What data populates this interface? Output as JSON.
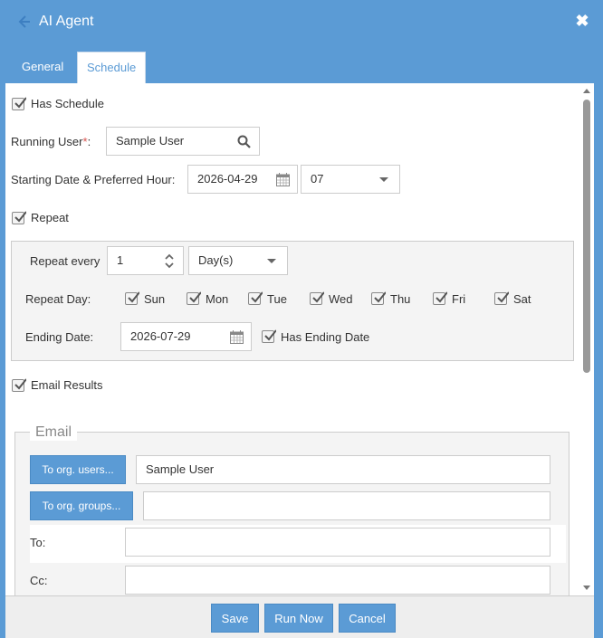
{
  "window": {
    "title": "AI Agent",
    "accent_color": "#5b9bd5"
  },
  "tabs": [
    "General",
    "Schedule"
  ],
  "active_tab": "Schedule",
  "schedule": {
    "has_schedule_label": "Has Schedule",
    "has_schedule_checked": true,
    "running_user_label": "Running User",
    "running_user_required": "*",
    "running_user_colon": ":",
    "running_user_value": "Sample  User",
    "starting_label": "Starting Date & Preferred Hour:",
    "starting_date": "2026-04-29",
    "preferred_hour": "07",
    "repeat_label": "Repeat",
    "repeat_checked": true,
    "repeat_every_label": "Repeat every",
    "repeat_every_value": "1",
    "repeat_unit": "Day(s)",
    "repeat_day_label": "Repeat Day:",
    "days": [
      "Sun",
      "Mon",
      "Tue",
      "Wed",
      "Thu",
      "Fri",
      "Sat"
    ],
    "ending_date_label": "Ending Date:",
    "ending_date": "2026-07-29",
    "has_ending_date_label": "Has Ending Date",
    "email_results_label": "Email Results"
  },
  "email": {
    "legend": "Email",
    "to_org_users_button": "To org. users...",
    "to_org_users_value": "Sample  User",
    "to_org_groups_button": "To org. groups...",
    "to_org_groups_value": "",
    "to_label": "To:",
    "to_value": "",
    "cc_label": "Cc:",
    "cc_value": ""
  },
  "footer": {
    "save": "Save",
    "run_now": "Run Now",
    "cancel": "Cancel"
  }
}
